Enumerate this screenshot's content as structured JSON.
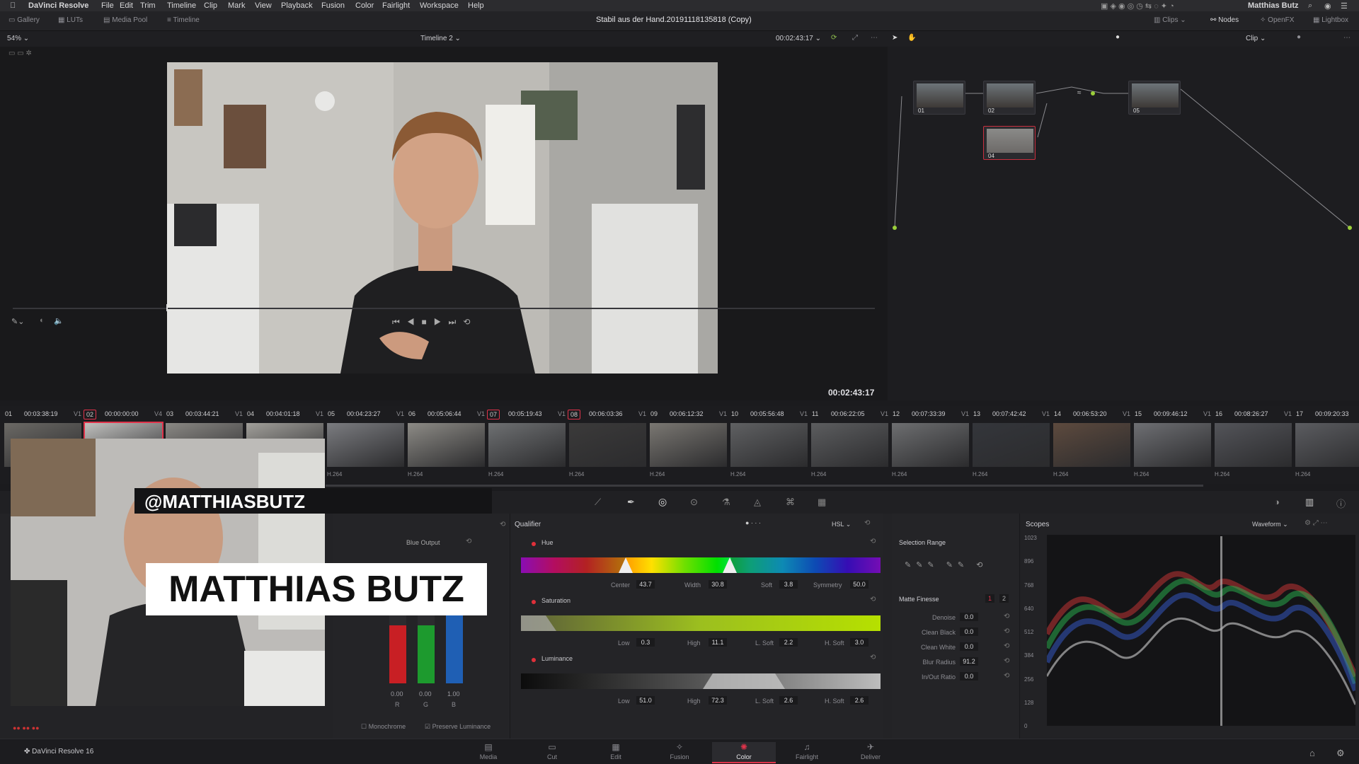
{
  "menubar": {
    "app": "DaVinci Resolve",
    "menus": [
      "File",
      "Edit",
      "Trim",
      "Timeline",
      "Clip",
      "Mark",
      "View",
      "Playback",
      "Fusion",
      "Color",
      "Fairlight",
      "Workspace",
      "Help"
    ],
    "user": "Matthias Butz"
  },
  "appbar": {
    "tabs": [
      "Gallery",
      "LUTs",
      "Media Pool",
      "Timeline"
    ],
    "project_title": "Stabil aus der Hand.20191118135818 (Copy)",
    "right_tabs": [
      "Clips",
      "Nodes",
      "OpenFX",
      "Lightbox"
    ]
  },
  "viewer": {
    "zoom": "54%",
    "timeline_name": "Timeline 2",
    "timecode_top": "00:02:43:17",
    "timecode": "00:02:43:17",
    "node_mode": "Clip"
  },
  "nodes": [
    {
      "label": "01"
    },
    {
      "label": "02"
    },
    {
      "label": "05"
    },
    {
      "label": "04"
    }
  ],
  "clips": [
    {
      "num": "01",
      "tc": "00:03:38:19",
      "track": "V1",
      "fmt": ""
    },
    {
      "num": "02",
      "tc": "00:00:00:00",
      "track": "V4",
      "fmt": ""
    },
    {
      "num": "03",
      "tc": "00:03:44:21",
      "track": "V1",
      "fmt": ""
    },
    {
      "num": "04",
      "tc": "00:04:01:18",
      "track": "V1",
      "fmt": ""
    },
    {
      "num": "05",
      "tc": "00:04:23:27",
      "track": "V1",
      "fmt": "H.264"
    },
    {
      "num": "06",
      "tc": "00:05:06:44",
      "track": "V1",
      "fmt": "H.264"
    },
    {
      "num": "07",
      "tc": "00:05:19:43",
      "track": "V1",
      "fmt": "H.264"
    },
    {
      "num": "08",
      "tc": "00:06:03:36",
      "track": "V1",
      "fmt": "H.264"
    },
    {
      "num": "09",
      "tc": "00:06:12:32",
      "track": "V1",
      "fmt": "H.264"
    },
    {
      "num": "10",
      "tc": "00:05:56:48",
      "track": "V1",
      "fmt": "H.264"
    },
    {
      "num": "11",
      "tc": "00:06:22:05",
      "track": "V1",
      "fmt": "H.264"
    },
    {
      "num": "12",
      "tc": "00:07:33:39",
      "track": "V1",
      "fmt": "H.264"
    },
    {
      "num": "13",
      "tc": "00:07:42:42",
      "track": "V1",
      "fmt": "H.264"
    },
    {
      "num": "14",
      "tc": "00:06:53:20",
      "track": "V1",
      "fmt": "H.264"
    },
    {
      "num": "15",
      "tc": "00:09:46:12",
      "track": "V1",
      "fmt": "H.264"
    },
    {
      "num": "16",
      "tc": "00:08:26:27",
      "track": "V1",
      "fmt": "H.264"
    },
    {
      "num": "17",
      "tc": "00:09:20:33",
      "track": "",
      "fmt": "H.264"
    }
  ],
  "rgbmixer": {
    "title": "Blue Output",
    "values": [
      "0.00",
      "0.00",
      "1.00"
    ],
    "channels": [
      "R",
      "G",
      "B"
    ],
    "monochrome": "Monochrome",
    "preserve": "Preserve Luminance",
    "bars": {
      "r": 0.0,
      "g": 0.0,
      "b": 1.0
    }
  },
  "qualifier": {
    "title": "Qualifier",
    "mode": "HSL",
    "hue": {
      "label": "Hue",
      "center_l": "Center",
      "center": "43.7",
      "width_l": "Width",
      "width": "30.8",
      "soft_l": "Soft",
      "soft": "3.8",
      "sym_l": "Symmetry",
      "sym": "50.0"
    },
    "sat": {
      "label": "Saturation",
      "low_l": "Low",
      "low": "0.3",
      "high_l": "High",
      "high": "11.1",
      "lsoft_l": "L. Soft",
      "lsoft": "2.2",
      "hsoft_l": "H. Soft",
      "hsoft": "3.0"
    },
    "lum": {
      "label": "Luminance",
      "low_l": "Low",
      "low": "51.0",
      "high_l": "High",
      "high": "72.3",
      "lsoft_l": "L. Soft",
      "lsoft": "2.6",
      "hsoft_l": "H. Soft",
      "hsoft": "2.6"
    }
  },
  "selection": {
    "title": "Selection Range",
    "matte": "Matte Finesse",
    "tabs": [
      "1",
      "2"
    ],
    "rows": [
      {
        "label": "Denoise",
        "value": "0.0"
      },
      {
        "label": "Clean Black",
        "value": "0.0"
      },
      {
        "label": "Clean White",
        "value": "0.0"
      },
      {
        "label": "Blur Radius",
        "value": "91.2"
      },
      {
        "label": "In/Out Ratio",
        "value": "0.0"
      }
    ]
  },
  "scopes": {
    "title": "Scopes",
    "mode": "Waveform",
    "ticks": [
      "1023",
      "896",
      "768",
      "640",
      "512",
      "384",
      "256",
      "128",
      "0"
    ]
  },
  "overlay": {
    "handle": "@MATTHIASBUTZ",
    "name": "MATTHIAS BUTZ"
  },
  "footer": {
    "app_version": "DaVinci Resolve 16",
    "pages": [
      "Media",
      "Cut",
      "Edit",
      "Fusion",
      "Color",
      "Fairlight",
      "Deliver"
    ],
    "active_page": "Color"
  },
  "colors": {
    "accent": "#e0334a",
    "hue_dot": "#e0303a"
  },
  "icons": [
    "apple-icon",
    "gallery-icon",
    "lut-icon",
    "media-pool-icon",
    "timeline-icon",
    "play-icon",
    "stop-icon",
    "loop-icon",
    "home-icon",
    "gear-icon"
  ]
}
